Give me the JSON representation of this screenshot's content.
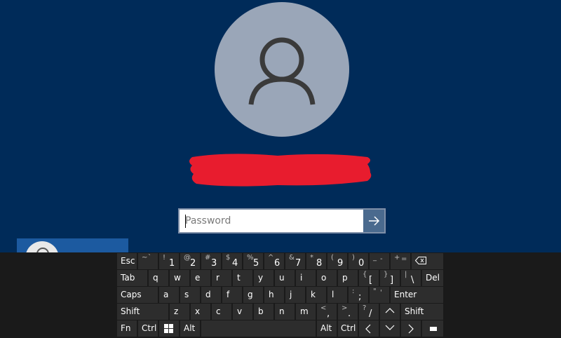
{
  "login": {
    "password_placeholder": "Password"
  },
  "colors": {
    "background": "#002b59",
    "avatar": "#9aa6b8",
    "redaction": "#e81c2e",
    "keyboard": "#1a1a1a",
    "key": "#2d2d2d",
    "user_tile": "#1c5aa0"
  },
  "icons": {
    "avatar": "person-icon",
    "submit": "arrow-right-icon",
    "backspace": "backspace-icon",
    "windows": "windows-icon"
  },
  "keyboard": {
    "row1": {
      "esc": "Esc",
      "k_tilde": {
        "top": "~",
        "bot": "`"
      },
      "k_1": {
        "top": "!",
        "bot": "1"
      },
      "k_2": {
        "top": "@",
        "bot": "2"
      },
      "k_3": {
        "top": "#",
        "bot": "3"
      },
      "k_4": {
        "top": "$",
        "bot": "4"
      },
      "k_5": {
        "top": "%",
        "bot": "5"
      },
      "k_6": {
        "top": "^",
        "bot": "6"
      },
      "k_7": {
        "top": "&",
        "bot": "7"
      },
      "k_8": {
        "top": "*",
        "bot": "8"
      },
      "k_9": {
        "top": "(",
        "bot": "9"
      },
      "k_0": {
        "top": ")",
        "bot": "0"
      },
      "k_minus": {
        "top": "_",
        "bot": "-"
      },
      "k_equal": {
        "top": "+",
        "bot": "="
      }
    },
    "row2": {
      "tab": "Tab",
      "letters": [
        "q",
        "w",
        "e",
        "r",
        "t",
        "y",
        "u",
        "i",
        "o",
        "p"
      ],
      "k_lbrace": {
        "top": "{",
        "bot": "["
      },
      "k_rbrace": {
        "top": "}",
        "bot": "]"
      },
      "k_pipe": {
        "top": "|",
        "bot": "\\"
      },
      "del": "Del"
    },
    "row3": {
      "caps": "Caps",
      "letters": [
        "a",
        "s",
        "d",
        "f",
        "g",
        "h",
        "j",
        "k",
        "l"
      ],
      "k_colon": {
        "top": ":",
        "bot": ";"
      },
      "k_quote": {
        "top": "\"",
        "bot": "'"
      },
      "enter": "Enter"
    },
    "row4": {
      "shift_left": "Shift",
      "letters": [
        "z",
        "x",
        "c",
        "v",
        "b",
        "n",
        "m"
      ],
      "k_lt": {
        "top": "<",
        "bot": ","
      },
      "k_gt": {
        "top": ">",
        "bot": "."
      },
      "k_question": {
        "top": "?",
        "bot": "/"
      },
      "shift_right": "Shift"
    },
    "row5": {
      "fn": "Fn",
      "ctrl_left": "Ctrl",
      "alt_left": "Alt",
      "alt_right": "Alt",
      "ctrl_right": "Ctrl"
    }
  }
}
